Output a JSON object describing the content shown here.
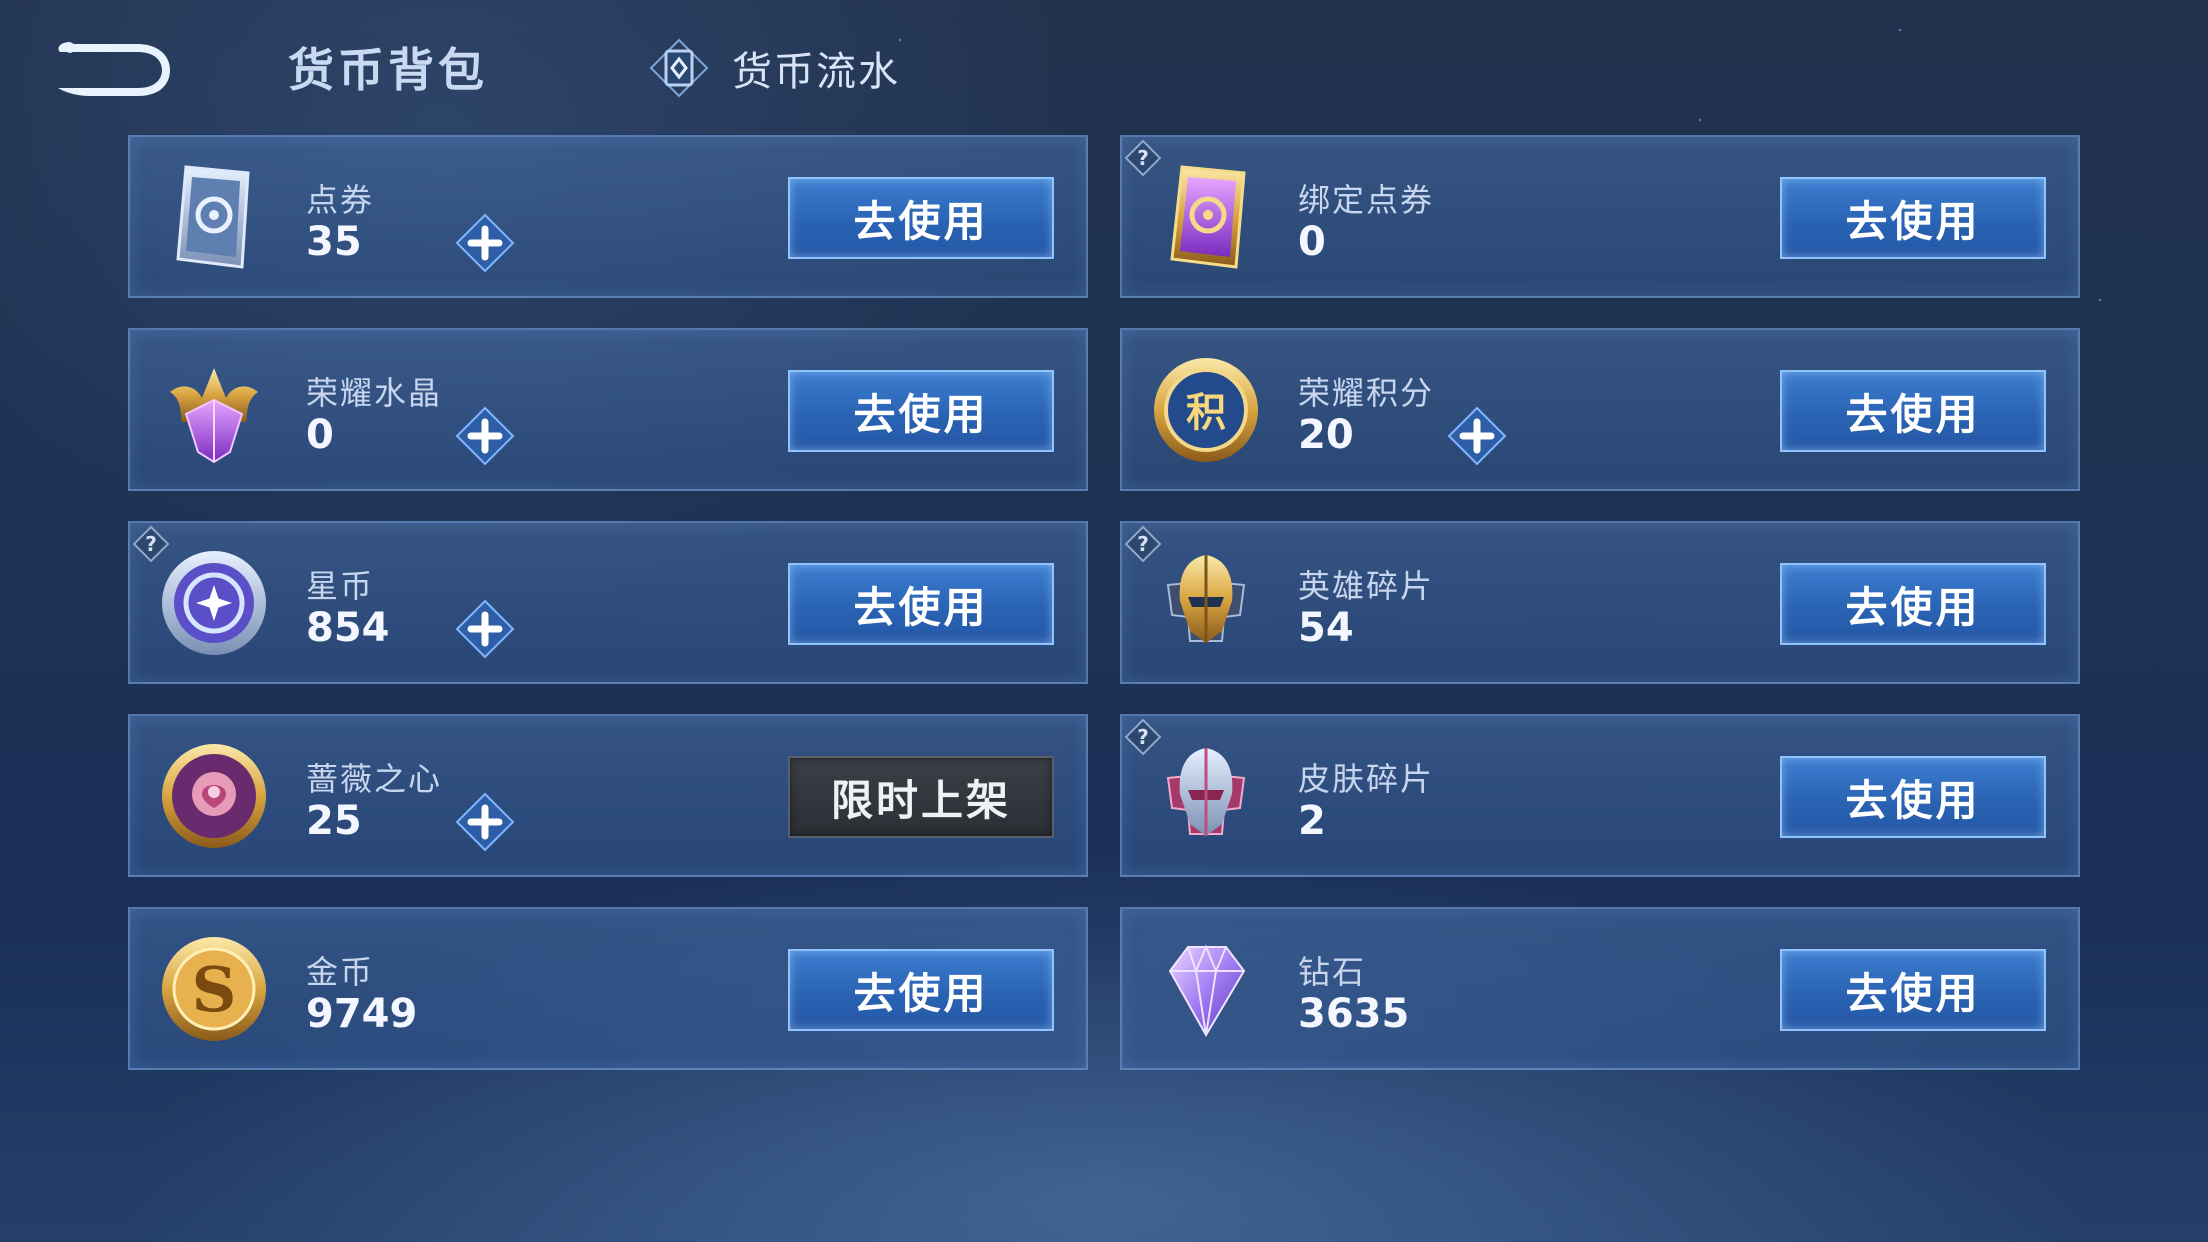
{
  "header": {
    "title": "货币背包",
    "flow_tab": "货币流水",
    "back_icon": "back-arrow-icon",
    "flow_icon": "ledger-icon"
  },
  "colors": {
    "button_blue": "#2a63b4",
    "button_gray": "#2b2f35",
    "card_bg": "#36588f"
  },
  "items": [
    {
      "name": "点券",
      "amount": "35",
      "button": "去使用",
      "plus": true,
      "help": false,
      "icon": "voucher-icon"
    },
    {
      "name": "绑定点券",
      "amount": "0",
      "button": "去使用",
      "plus": false,
      "help": true,
      "icon": "bound-voucher-icon"
    },
    {
      "name": "荣耀水晶",
      "amount": "0",
      "button": "去使用",
      "plus": true,
      "help": false,
      "icon": "glory-crystal-icon"
    },
    {
      "name": "荣耀积分",
      "amount": "20",
      "button": "去使用",
      "plus": true,
      "help": false,
      "icon": "glory-points-icon"
    },
    {
      "name": "星币",
      "amount": "854",
      "button": "去使用",
      "plus": true,
      "help": true,
      "icon": "star-coin-icon"
    },
    {
      "name": "英雄碎片",
      "amount": "54",
      "button": "去使用",
      "plus": false,
      "help": true,
      "icon": "hero-fragment-icon"
    },
    {
      "name": "蔷薇之心",
      "amount": "25",
      "button": "限时上架",
      "plus": true,
      "help": false,
      "icon": "rose-heart-icon"
    },
    {
      "name": "皮肤碎片",
      "amount": "2",
      "button": "去使用",
      "plus": false,
      "help": true,
      "icon": "skin-fragment-icon"
    },
    {
      "name": "金币",
      "amount": "9749",
      "button": "去使用",
      "plus": false,
      "help": false,
      "icon": "gold-coin-icon"
    },
    {
      "name": "钻石",
      "amount": "3635",
      "button": "去使用",
      "plus": false,
      "help": false,
      "icon": "diamond-icon"
    }
  ]
}
